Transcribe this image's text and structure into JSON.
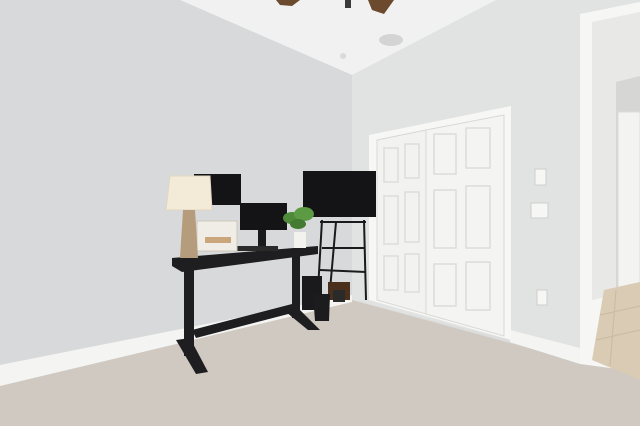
{
  "image": {
    "kind": "photo",
    "description_visible": false
  },
  "palette": {
    "wall_left": "#d7d9da",
    "wall_right": "#e1e2e2",
    "ceiling": "#eeeeee",
    "carpet": "#cfc9c1",
    "trim": "#f4f4f2",
    "door": "#f2f2f0",
    "desk": "#1e1e20",
    "monitor": "#141416",
    "lamp_shade": "#f3ead8",
    "lamp_base": "#b59c7c",
    "plant": "#4f8a3a",
    "hall_floor": "#d9cbb4"
  }
}
